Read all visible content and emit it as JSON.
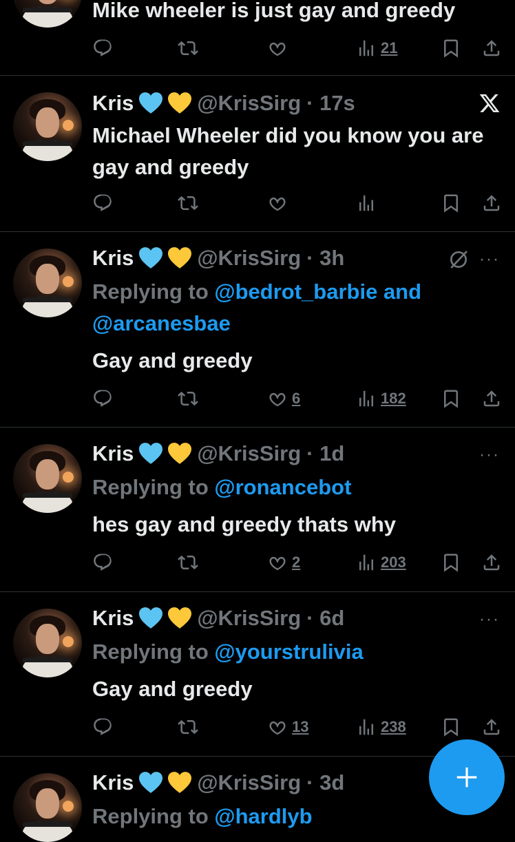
{
  "colors": {
    "background": "#000000",
    "text": "#e7e9ea",
    "muted": "#71767b",
    "accent": "#1d9bf0",
    "divider": "#2f3336"
  },
  "tweets": [
    {
      "text": "Mike wheeler is just gay and greedy",
      "stats": {
        "views": "21"
      }
    },
    {
      "name": "Kris",
      "emoji": [
        "blue-heart-icon",
        "yellow-heart-icon"
      ],
      "handle": "@KrisSirg",
      "time": "· 17s",
      "text": "Michael Wheeler did you know you are gay and greedy",
      "stats": {}
    },
    {
      "name": "Kris",
      "handle": "@KrisSirg",
      "time": "· 3h",
      "reply_prefix": "Replying to ",
      "reply_mentions": [
        "@bedrot_barbie",
        " and ",
        "@arcanesbae"
      ],
      "text": "Gay and greedy",
      "stats": {
        "likes": "6",
        "views": "182"
      }
    },
    {
      "name": "Kris",
      "handle": "@KrisSirg",
      "time": "· 1d",
      "reply_prefix": "Replying to ",
      "reply_mentions": [
        "@ronancebot"
      ],
      "text": "hes gay and greedy thats why",
      "stats": {
        "likes": "2",
        "views": "203"
      }
    },
    {
      "name": "Kris",
      "handle": "@KrisSirg",
      "time": "· 6d",
      "reply_prefix": "Replying to ",
      "reply_mentions": [
        "@yourstrulivia"
      ],
      "text": "Gay and greedy",
      "stats": {
        "likes": "13",
        "views": "238"
      }
    },
    {
      "name": "Kris",
      "handle": "@KrisSirg",
      "time": "· 3d",
      "reply_prefix": "Replying to ",
      "reply_mentions": [
        "@hardlyb"
      ]
    }
  ],
  "more_label": "···"
}
